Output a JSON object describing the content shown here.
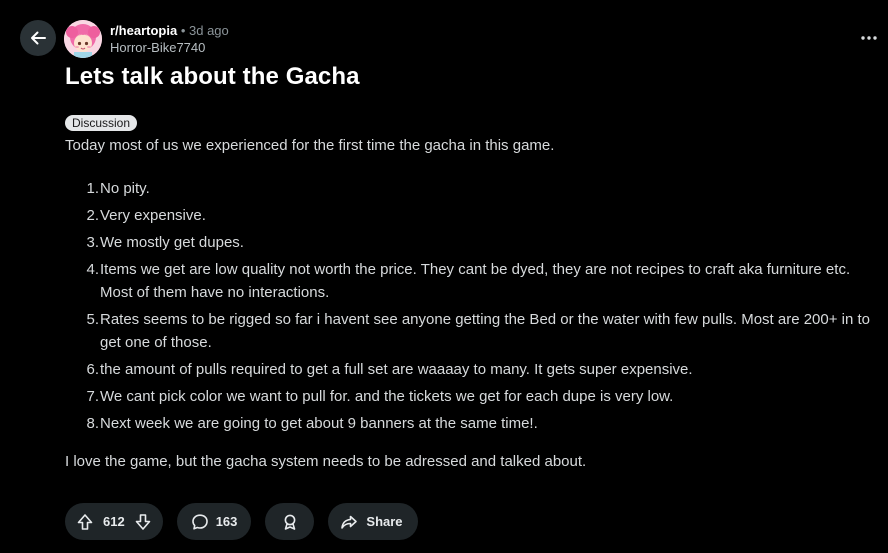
{
  "post": {
    "subreddit": "r/heartopia",
    "separator": "•",
    "age": "3d ago",
    "author": "Horror-Bike7740",
    "title": "Lets talk about the Gacha",
    "flair": "Discussion",
    "intro": "Today most of us we experienced for the first time the gacha in this game.",
    "items": [
      {
        "num": "1.",
        "text": "No pity."
      },
      {
        "num": "2.",
        "text": "Very expensive."
      },
      {
        "num": "3.",
        "text": "We mostly get dupes."
      },
      {
        "num": "4.",
        "text": "Items we get are low quality not worth the price. They cant be dyed, they are not recipes to craft aka furniture etc. Most of them have no interactions."
      },
      {
        "num": "5.",
        "text": "Rates seems to be rigged so far i havent see anyone getting the Bed or the water with few pulls. Most are 200+ in to get one of those."
      },
      {
        "num": "6.",
        "text": "the amount of pulls required to get a full set are waaaay to many. It gets super expensive."
      },
      {
        "num": "7.",
        "text": "We cant pick color we want to pull for. and the tickets we get for each dupe is very low."
      },
      {
        "num": "8.",
        "text": "Next week we are going to get about 9 banners at the same time!."
      }
    ],
    "outro": "I love the game, but the gacha system needs to be adressed and talked about."
  },
  "actions": {
    "votes": "612",
    "comments": "163",
    "share_label": "Share"
  },
  "icons": {
    "back": "arrow-left-icon",
    "more": "more-horizontal-icon",
    "upvote": "arrow-up-icon",
    "downvote": "arrow-down-icon",
    "comment": "comment-bubble-icon",
    "award": "award-icon",
    "share": "share-arrow-icon"
  },
  "colors": {
    "background": "#000000",
    "pill": "#1f2528",
    "title": "#ffffff",
    "flair_bg": "#e5e7e9"
  }
}
